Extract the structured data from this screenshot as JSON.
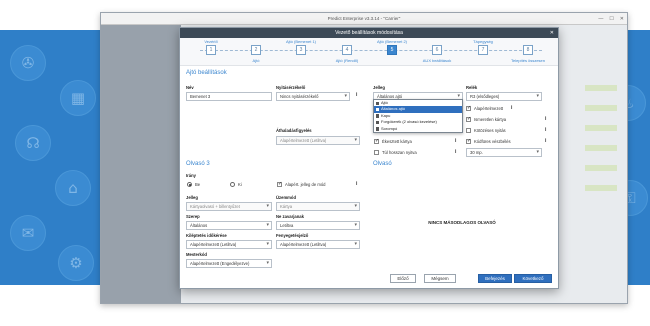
{
  "app": {
    "title": "Predict Enterprise v3.3.14 - \"Carrier\"",
    "window_controls": [
      "—",
      "☐",
      "✕"
    ]
  },
  "modal": {
    "title": "Vezető beállítások módosítása",
    "close": "✕"
  },
  "steps": {
    "numbers": [
      "1",
      "2",
      "3",
      "4",
      "5",
      "6",
      "7",
      "8"
    ],
    "labels_top": [
      "Vezérlő",
      "Ajtó (Bemenet 1)",
      "Ajtó (Bemenet 2)",
      "Tápegység"
    ],
    "labels_bottom": [
      "Ajtó",
      "Ajtó (Rendő)",
      "AUX beállítások",
      "Telepítés összesen"
    ]
  },
  "left": {
    "section_title": "Ajtó beállítások",
    "name_label": "Név",
    "name_value": "Bemenet 3",
    "reader_label": "Nyitásérzékelő",
    "reader_value": "Nincs nyitásérzékelő",
    "switch_label": "Áthaladásfigyelés",
    "switch_value": "Alapértelmezett (Letiltva)",
    "reader_section": "Olvasó 3",
    "direction_label": "Irány",
    "direction_in": "Be",
    "direction_out": "Ki",
    "apply_type_label": "Alapért. jelleg de mód",
    "type_label": "Jelleg",
    "type_value": "Kártyaolvasó + billentyűzet",
    "mode_label": "Üzemmód",
    "mode_value": "Kártya",
    "color_label": "Szerep",
    "color_value": "Általános",
    "not_used_label": "Ne zavarjanak",
    "not_used_value": "Letiltva",
    "exit_label": "Kiléptetés időkérése",
    "exit_value": "Alapértelmezett (Letiltva)",
    "led_label": "Fenyegetésjelző",
    "led_value": "Alapértelmezett (Letiltva)",
    "master_label": "Mesterkód",
    "master_value": "Alapértelmezett (Engedélyezve)"
  },
  "right": {
    "jelleg_label": "Jelleg",
    "jelleg_value": "Általános ajtó",
    "options": [
      "Ajtó",
      "Általános ajtó",
      "Kapu",
      "Forgókerék (2 olvasó kezelése)",
      "Sorompó"
    ],
    "selected_index": 1,
    "behavior_label": "Relék",
    "behavior_value": "R3 (elsődleges)",
    "chk_default": "Alapértelmezett",
    "chk_open": "Ismeretlen kártya",
    "chk_kiosk": "Kötözéses nyitás",
    "chk_card": "Kódfüres vészbélés",
    "delay_label": "Ékesztett kártya",
    "delay_value": "30 mp.",
    "alarm_label": "Túl hosszan nyitva",
    "reader_section": "Olvasó",
    "preview_text": "NINCS MÁSODLAGOS OLVASÓ"
  },
  "buttons": {
    "prev": "Előző",
    "cancel": "Mégsem",
    "finish": "Befejezés",
    "next": "Következő"
  },
  "bg_icons": [
    "✇",
    "▦",
    "☊",
    "⌂",
    "✉",
    "⚙",
    "☏",
    "♨",
    "✈",
    "⚿",
    "☗",
    "⏣",
    "♪",
    "⚓"
  ]
}
